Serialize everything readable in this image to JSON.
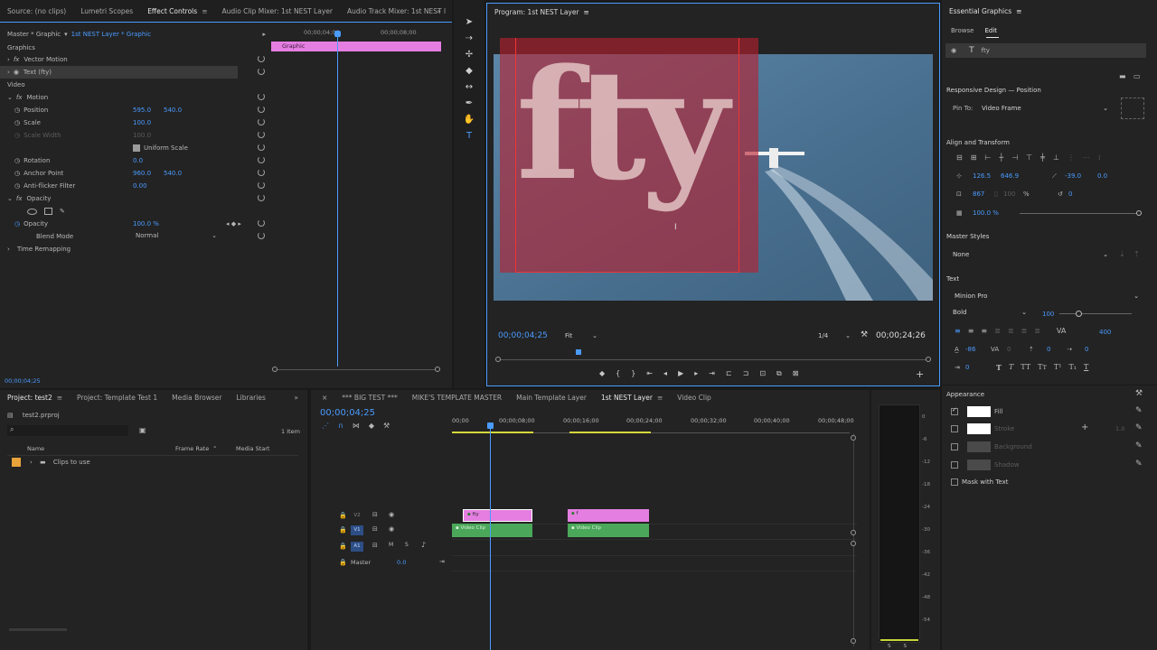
{
  "source_panel": {
    "tabs": [
      "Source: (no clips)",
      "Lumetri Scopes",
      "Effect Controls",
      "Audio Clip Mixer: 1st NEST Layer",
      "Audio Track Mixer: 1st NEST l"
    ],
    "active_tab": "Effect Controls",
    "master_label": "Master * Graphic",
    "clip_label": "1st NEST Layer * Graphic",
    "timecodes": [
      "00;00;04;00",
      "00;00;08;00"
    ],
    "graphic_bar": "Graphic",
    "sections": {
      "graphics": "Graphics",
      "video": "Video"
    },
    "vector_motion": "Vector Motion",
    "text_layer": "Text (fty)",
    "motion": "Motion",
    "position": {
      "label": "Position",
      "x": "595.0",
      "y": "540.0"
    },
    "scale": {
      "label": "Scale",
      "value": "100.0"
    },
    "scale_width": {
      "label": "Scale Width",
      "value": "100.0"
    },
    "uniform_scale": "Uniform Scale",
    "rotation": {
      "label": "Rotation",
      "value": "0.0"
    },
    "anchor_point": {
      "label": "Anchor Point",
      "x": "960.0",
      "y": "540.0"
    },
    "anti_flicker": {
      "label": "Anti-flicker Filter",
      "value": "0.00"
    },
    "opacity_section": "Opacity",
    "opacity": {
      "label": "Opacity",
      "value": "100.0 %"
    },
    "blend_mode": {
      "label": "Blend Mode",
      "value": "Normal"
    },
    "time_remapping": "Time Remapping",
    "footer_tc": "00;00;04;25"
  },
  "program": {
    "title": "Program: 1st NEST Layer",
    "overlay_text": "fty",
    "timecode": "00;00;04;25",
    "fit": "Fit",
    "resolution": "1/4",
    "duration": "00;00;24;26"
  },
  "essential": {
    "title": "Essential Graphics",
    "tabs": [
      "Browse",
      "Edit"
    ],
    "layer_name": "fty",
    "responsive": "Responsive Design — Position",
    "pin_to_label": "Pin To:",
    "pin_to_value": "Video Frame",
    "align_transform": "Align and Transform",
    "pos_x": "126.5",
    "pos_y": "646.9",
    "rotation": "-39.0",
    "rotation2": "0.0",
    "width": "867",
    "height": "100",
    "pct": "%",
    "rot": "0",
    "opacity": "100.0 %",
    "master_styles": "Master Styles",
    "master_style_value": "None",
    "text_section": "Text",
    "font": "Minion Pro",
    "style": "Bold",
    "size": "100",
    "tracking": "400",
    "kerning": "-86",
    "leading": "0",
    "baseline": "0",
    "tsume": "0",
    "indent": "0",
    "appearance": "Appearance",
    "fill": "Fill",
    "stroke": "Stroke",
    "stroke_size": "1.0",
    "background": "Background",
    "shadow": "Shadow",
    "mask": "Mask with Text"
  },
  "project": {
    "tabs": [
      "Project: test2",
      "Project: Template Test 1",
      "Media Browser",
      "Libraries"
    ],
    "file": "test2.prproj",
    "items_count": "1 Item",
    "columns": [
      "Name",
      "Frame Rate",
      "Media Start"
    ],
    "bin": "Clips to use"
  },
  "timeline": {
    "tabs": [
      "*** BIG TEST ***",
      "MIKE'S TEMPLATE MASTER",
      "Main Template Layer",
      "1st NEST Layer",
      "Video Clip"
    ],
    "active_tab": "1st NEST Layer",
    "timecode": "00;00;04;25",
    "ruler": [
      "00;00",
      "00;00;08;00",
      "00;00;16;00",
      "00;00;24;00",
      "00;00;32;00",
      "00;00;40;00",
      "00;00;48;00"
    ],
    "tracks": {
      "v2": "V2",
      "v1": "V1",
      "a1": "A1",
      "master": "Master",
      "master_val": "0.0"
    },
    "clips": {
      "graphic1": "fty",
      "graphic2": "f",
      "video1": "Video Clip",
      "video2": "Video Clip"
    }
  },
  "meter": {
    "scale": [
      "0",
      "-6",
      "-12",
      "-18",
      "-24",
      "-30",
      "-36",
      "-42",
      "-48",
      "-54"
    ],
    "bottom": [
      "S",
      "S"
    ]
  },
  "colors": {
    "accent": "#4a9bff",
    "graphic_clip": "#e57ee1",
    "video_clip": "#4ba85a",
    "selection_red": "#b8202e"
  }
}
